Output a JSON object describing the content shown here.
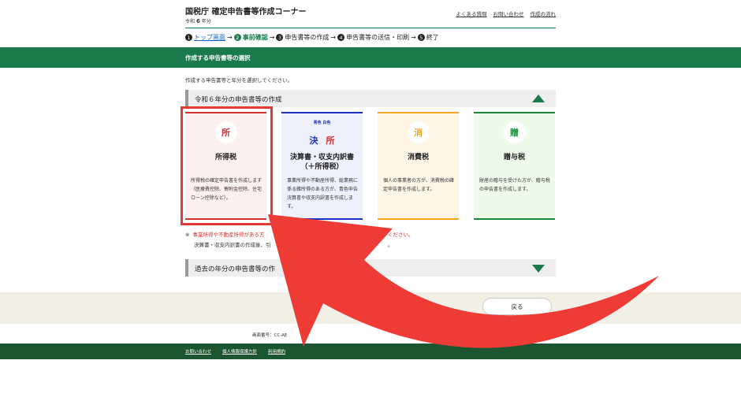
{
  "header": {
    "title": "国税庁 確定申告書等作成コーナー",
    "era_prefix": "令和",
    "era_year": "6",
    "era_suffix": "年分",
    "links": [
      "よくある質問",
      "お問い合わせ",
      "作成の流れ"
    ]
  },
  "steps": [
    {
      "num": "1",
      "label": "トップ画面"
    },
    {
      "num": "2",
      "label": "事前確認"
    },
    {
      "num": "3",
      "label": "申告書等の作成"
    },
    {
      "num": "4",
      "label": "申告書等の送信・印刷"
    },
    {
      "num": "5",
      "label": "終了"
    }
  ],
  "section": {
    "title": "作成する申告書等の選択",
    "instruction": "作成する申告書等と年分を選択してください。"
  },
  "accordion_current": {
    "label": "令和６年分の申告書等の作成"
  },
  "cards": [
    {
      "icon_char": "所",
      "name": "所得税",
      "desc": "所得税の確定申告書を作成します（医療費控除、寄附金控除、住宅ローン控除など）。"
    },
    {
      "small_label": "青色 白色",
      "icon_char_1": "決",
      "icon_char_2": "所",
      "name_line1": "決算書・収支内訳書",
      "name_line2": "（＋所得税）",
      "desc": "事業所得や不動産所得、総業務に係る雑所得のある方が、青色申告決算書や収支内訳書を作成します。"
    },
    {
      "icon_char": "消",
      "name": "消費税",
      "desc": "個人の事業者の方が、消費税の確定申告書を作成します。"
    },
    {
      "icon_char": "贈",
      "name": "贈与税",
      "desc": "財産の贈与を受けた方が、贈与税の申告書を作成します。"
    }
  ],
  "notes": {
    "mark": "※",
    "line1_start": "事業所得や不動産所得がある方",
    "line1_end": "ください。",
    "line2_start": "決算書・収支内訳書の作成後、引",
    "line2_end": "。"
  },
  "accordion_past": {
    "label": "過去の年分の申告書等の作"
  },
  "footer": {
    "back_button": "戻る",
    "screen_id": "画面番号：CC-AE",
    "links": [
      "お問い合わせ",
      "個人情報保護方針",
      "利用規約"
    ]
  },
  "colors": {
    "brand_green": "#1a7a4c",
    "highlight_red": "#e53935",
    "arrow_red": "#ef3b36"
  }
}
